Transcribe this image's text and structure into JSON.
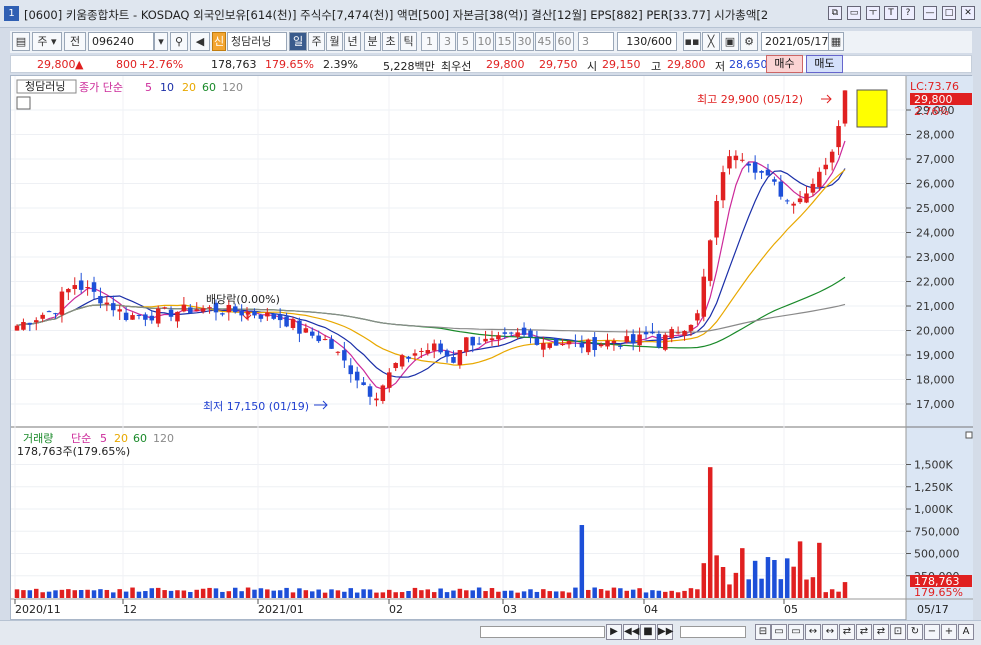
{
  "window": {
    "num": "1",
    "title": "[0600] 키움종합차트 - KOSDAQ 외국인보유[614(천)] 주식수[7,474(천)] 액면[500] 자본금[38(억)] 결산[12월] EPS[882] PER[33.77] 시가총액[2",
    "controls": [
      "⧉",
      "▭",
      "ㅜ",
      "T",
      "?",
      "—",
      "□",
      "✕"
    ]
  },
  "toolbar": {
    "period_type": "주",
    "all_label": "전",
    "code": "096240",
    "credit_label": "신",
    "stock_name": "청담러닝",
    "timeframes": [
      "일",
      "주",
      "월",
      "년",
      "분",
      "초",
      "틱"
    ],
    "minutes": [
      "1",
      "3",
      "5",
      "10",
      "15",
      "30",
      "45",
      "60"
    ],
    "custom_val": "3",
    "count": "130/600",
    "date": "2021/05/17"
  },
  "quote": {
    "price": "29,800",
    "arrow": "▲",
    "change": "800",
    "change_pct": "+2.76%",
    "volume": "178,763",
    "vol_ratio": "179.65%",
    "turnover": "2.39%",
    "amount": "5,228백만",
    "best_label": "최우선",
    "ask": "29,800",
    "bid": "29,750",
    "open_label": "시",
    "open": "29,150",
    "high_label": "고",
    "high": "29,800",
    "low_label": "저",
    "low": "28,650",
    "buy_label": "매수",
    "sell_label": "매도"
  },
  "price_panel": {
    "legend_name": "청담러닝",
    "legend_items": [
      "종가 단순",
      "5",
      "10",
      "20",
      "60",
      "120"
    ],
    "lc_label": "LC:73.76",
    "last_price_tag": "29,800",
    "last_pct_tag": "2.76%",
    "axis_labels": [
      "29,000",
      "28,000",
      "27,000",
      "26,000",
      "25,000",
      "24,000",
      "23,000",
      "22,000",
      "21,000",
      "20,000",
      "19,000",
      "18,000",
      "17,000"
    ],
    "high_annotation": "최고 29,900 (05/12)",
    "low_annotation": "최저 17,150 (01/19)",
    "dividend_annotation": "배당락(0.00%)"
  },
  "volume_panel": {
    "legend_items": [
      "거래량",
      "단순",
      "5",
      "20",
      "60",
      "120"
    ],
    "vol_text": "178,763주(179.65%)",
    "axis_labels": [
      "1,500K",
      "1,250K",
      "1,000K",
      "750,000",
      "500,000",
      "250,000"
    ],
    "last_vol_tag": "178,763",
    "last_pct_tag": "179.65%"
  },
  "x_axis": {
    "labels": [
      "2020/11",
      "12",
      "2021/01",
      "02",
      "03",
      "04",
      "05"
    ],
    "end_label": "05/17"
  },
  "colors": {
    "up": "#e02020",
    "down": "#1d4fd8",
    "ma5": "#cc2a9a",
    "ma10": "#1b2fa8",
    "ma20": "#e8a800",
    "ma60": "#1a8a2a",
    "ma120": "#8a8a8a"
  },
  "chart_data": {
    "type": "candlestick",
    "x_range": [
      "2020/11",
      "2021/05/17"
    ],
    "y_range": [
      16600,
      30200
    ],
    "volume_range": [
      0,
      1600000
    ],
    "last": {
      "price": 29800,
      "volume": 178763
    },
    "high": {
      "value": 29900,
      "date": "05/12"
    },
    "low": {
      "value": 17150,
      "date": "01/19"
    }
  }
}
